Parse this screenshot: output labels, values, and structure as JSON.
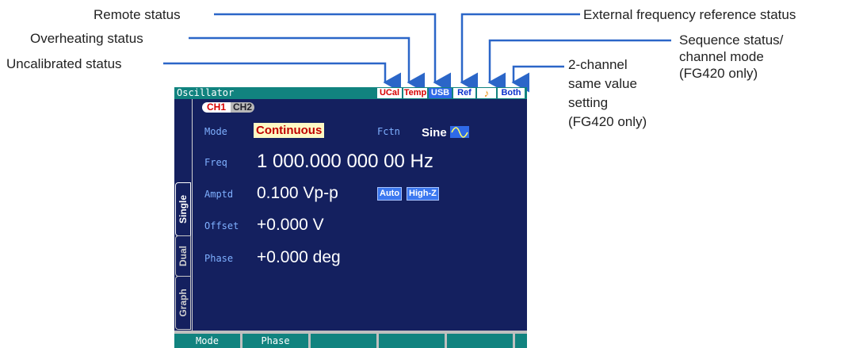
{
  "annotations": {
    "remote": "Remote status",
    "overheating": "Overheating status",
    "uncalibrated": "Uncalibrated status",
    "external_ref": "External frequency reference status",
    "sequence_1": "Sequence status/",
    "sequence_2": "channel mode",
    "sequence_3": "(FG420 only)",
    "same_value_1": "2-channel",
    "same_value_2": "same value",
    "same_value_3": "setting",
    "same_value_4": "(FG420 only)"
  },
  "screen": {
    "title": "Oscillator",
    "status_badges": {
      "ucal": "UCal",
      "temp": "Temp",
      "usb": "USB",
      "ref": "Ref",
      "sequence": "♪",
      "both": "Both"
    },
    "channel_tabs": {
      "ch1": "CH1",
      "ch2": "CH2"
    },
    "side_tabs": {
      "single": "Single",
      "dual": "Dual",
      "graph": "Graph"
    },
    "mode": {
      "label": "Mode",
      "value": "Continuous"
    },
    "fctn": {
      "label": "Fctn",
      "value": "Sine",
      "icon": "sine-wave-icon"
    },
    "freq": {
      "label": "Freq",
      "value": "1 000.000 000 00 Hz"
    },
    "amptd": {
      "label": "Amptd",
      "value": "0.100 Vp-p",
      "chip_auto": "Auto",
      "chip_highz": "High-Z"
    },
    "offset": {
      "label": "Offset",
      "value": "+0.000 V"
    },
    "phase": {
      "label": "Phase",
      "value": "+0.000 deg"
    },
    "softkeys": [
      "Mode",
      "Phase",
      "",
      "",
      "",
      ""
    ]
  },
  "colors": {
    "screen_bg": "#14205f",
    "title_bar": "#11837f",
    "label_text": "#7fb0ff",
    "annotation_line": "#2b66c8",
    "status_red": "#d60000",
    "status_blue": "#0a2fcc"
  }
}
